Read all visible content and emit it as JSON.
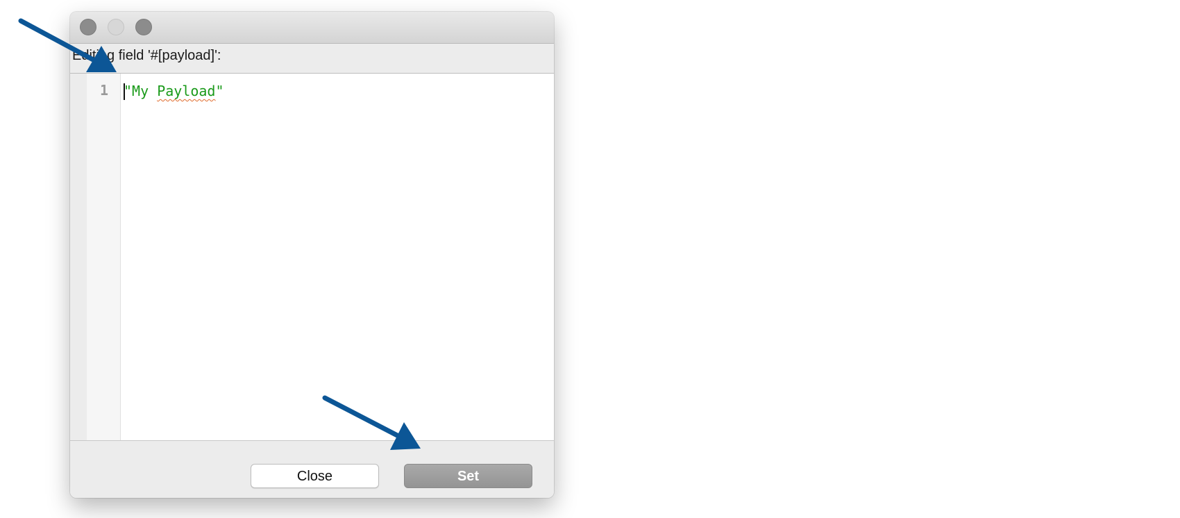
{
  "dialog": {
    "field_label": "Editing field '#[payload]':",
    "editor": {
      "line_number": "1",
      "code_open_quote": "\"",
      "code_word_1": "My",
      "code_space": " ",
      "code_word_2": "Payload",
      "code_close_quote": "\""
    },
    "buttons": {
      "close_label": "Close",
      "set_label": "Set"
    }
  },
  "colors": {
    "string_literal": "#1a9a1a",
    "annotation_arrow": "#0c5696",
    "set_button": "#9e9e9e"
  },
  "icons": {
    "window_controls": [
      "close-dot",
      "minimize-dot",
      "zoom-dot"
    ],
    "annotations": [
      "arrow-icon",
      "arrow-icon"
    ]
  }
}
